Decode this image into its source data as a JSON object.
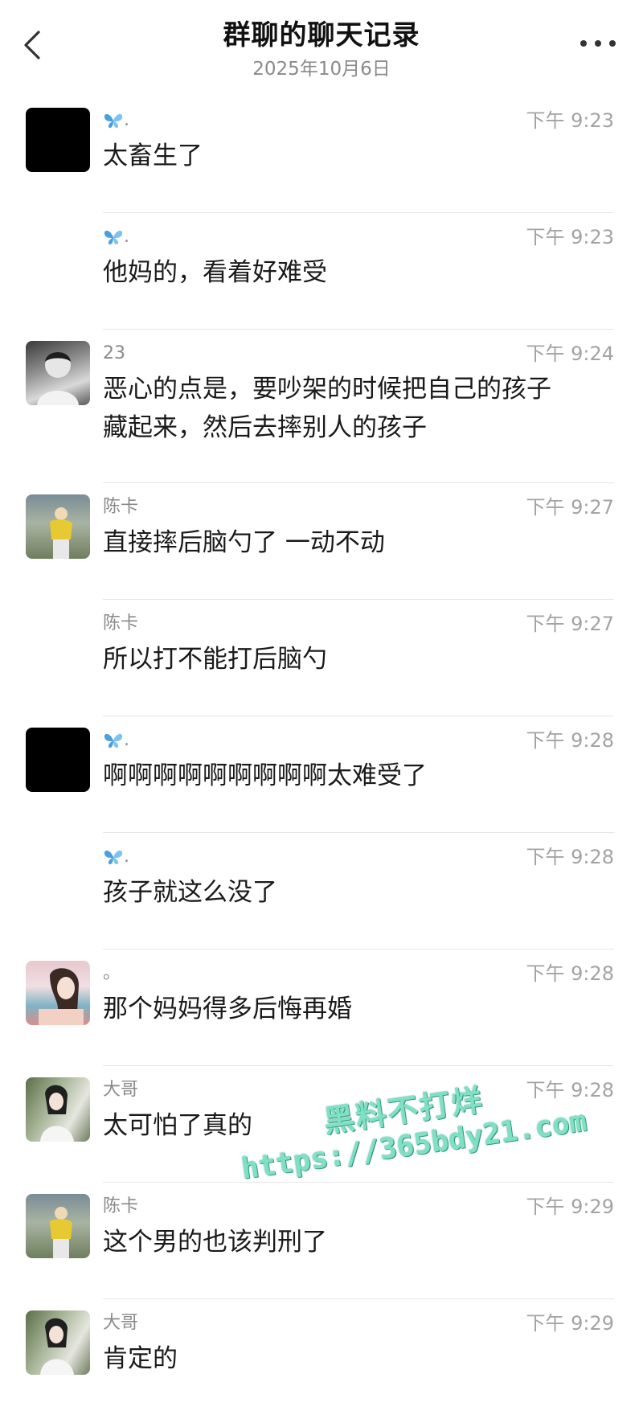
{
  "header": {
    "title": "群聊的聊天记录",
    "date": "2025年10月6日",
    "back_icon": "chevron-left-icon",
    "more_icon": "more-dots-icon"
  },
  "messages": [
    {
      "name": "𝗪.",
      "time": "下午 9:23",
      "text": "太畜生了"
    },
    {
      "name": "𝗪.",
      "time": "下午 9:23",
      "text": "他妈的，看着好难受"
    },
    {
      "name": "23",
      "time": "下午 9:24",
      "text": "恶心的点是，要吵架的时候把自己的孩子\n藏起来，然后去摔别人的孩子"
    },
    {
      "name": "陈卡",
      "time": "下午 9:27",
      "text": "直接摔后脑勺了 一动不动"
    },
    {
      "name": "陈卡",
      "time": "下午 9:27",
      "text": "所以打不能打后脑勺"
    },
    {
      "name": "𝗪.",
      "time": "下午 9:28",
      "text": "啊啊啊啊啊啊啊啊啊太难受了"
    },
    {
      "name": "𝗪.",
      "time": "下午 9:28",
      "text": "孩子就这么没了"
    },
    {
      "name": "。",
      "time": "下午 9:28",
      "text": "那个妈妈得多后悔再婚"
    },
    {
      "name": "大哥",
      "time": "下午 9:28",
      "text": "太可怕了真的"
    },
    {
      "name": "陈卡",
      "time": "下午 9:29",
      "text": "这个男的也该判刑了"
    },
    {
      "name": "大哥",
      "time": "下午 9:29",
      "text": "肯定的"
    }
  ],
  "watermark": {
    "line1": "黑料不打烊",
    "line2": "https://365bdy21.com"
  },
  "colors": {
    "butterfly": "#4a9fe0",
    "watermark": "#7fe0c4"
  }
}
